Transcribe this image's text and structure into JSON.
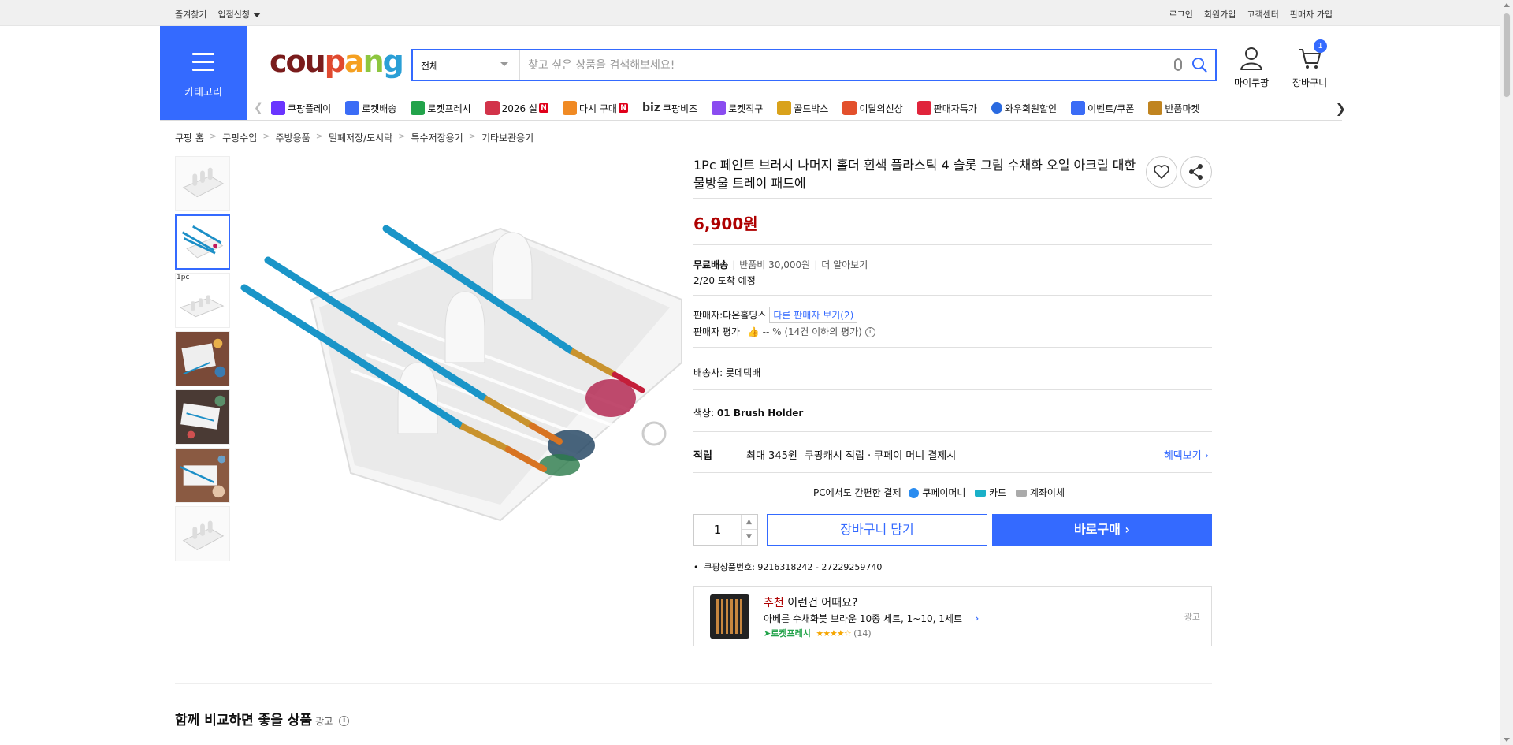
{
  "topbar": {
    "left": [
      "즐겨찾기",
      "입점신청"
    ],
    "right": [
      "로그인",
      "회원가입",
      "고객센터",
      "판매자 가입"
    ]
  },
  "header": {
    "category_label": "카테고리",
    "logo": [
      "c",
      "o",
      "u",
      "p",
      "a",
      "n",
      "g"
    ],
    "logo_colors": [
      "#7a1c1c",
      "#7a1c1c",
      "#7a1c1c",
      "#e0492f",
      "#f5a021",
      "#8dc63f",
      "#2a9fd6"
    ],
    "search_category": "전체",
    "search_placeholder": "찾고 싶은 상품을 검색해보세요!",
    "mycoupang": "마이쿠팡",
    "cart": "장바구니",
    "cart_count": "1"
  },
  "catnav": [
    {
      "label": "쿠팡플레이",
      "color": "#6a35ff",
      "badge": ""
    },
    {
      "label": "로켓배송",
      "color": "#3b6cf6",
      "badge": ""
    },
    {
      "label": "로켓프레시",
      "color": "#22a34a",
      "badge": ""
    },
    {
      "label": "2026 설",
      "color": "#d2334a",
      "badge": "N"
    },
    {
      "label": "다시 구매",
      "color": "#f08a24",
      "badge": "N"
    },
    {
      "label": "쿠팡비즈",
      "color": "#2b2b2b",
      "badge": "",
      "prefix": "biz"
    },
    {
      "label": "로켓직구",
      "color": "#8a4cf0",
      "badge": ""
    },
    {
      "label": "골드박스",
      "color": "#d9a21b",
      "badge": ""
    },
    {
      "label": "이달의신상",
      "color": "#e3502c",
      "badge": ""
    },
    {
      "label": "판매자특가",
      "color": "#e0243b",
      "badge": ""
    },
    {
      "label": "와우회원할인",
      "color": "#2a6ae0",
      "badge": "",
      "prefix": "wow"
    },
    {
      "label": "이벤트/쿠폰",
      "color": "#3b6cf6",
      "badge": ""
    },
    {
      "label": "반품마켓",
      "color": "#c08420",
      "badge": ""
    }
  ],
  "breadcrumb": [
    "쿠팡 홈",
    "쿠팡수입",
    "주방용품",
    "밀폐저장/도시락",
    "특수저장용기",
    "기타보관용기"
  ],
  "thumb_label": "1pc",
  "product": {
    "title": "1Pc 페인트 브러시 나머지 홀더 흰색 플라스틱 4 슬롯 그림 수채화 오일 아크릴 대한 물방울 트레이 패드에",
    "price": "6,900원",
    "free_shipping": "무료배송",
    "return_fee": "반품비 30,000원",
    "more": "더 알아보기",
    "arrival": "2/20 도착 예정",
    "seller_label": "판매자:",
    "seller": "다온홀딩스",
    "other_sellers": "다른 판매자 보기(2)",
    "seller_rating_label": "판매자 평가",
    "seller_rating": "-- % (14건 이하의 평가)",
    "courier_label": "배송사:",
    "courier": "롯데택배",
    "color_label": "색상:",
    "color_value": "01 Brush Holder",
    "reward_label": "적립",
    "reward_text1": "최대 345원",
    "reward_text2": "쿠팡캐시 적립",
    "reward_text3": "· 쿠페이 머니 결제시",
    "benefit": "혜택보기",
    "pay_title": "PC에서도 간편한 결제",
    "pay_methods": [
      "쿠페이머니",
      "카드",
      "계좌이체"
    ],
    "qty": "1",
    "add_cart": "장바구니 담기",
    "buy_now": "바로구매",
    "product_no": "쿠팡상품번호: 9216318242 - 27229259740"
  },
  "recommend": {
    "tag": "추천",
    "title": "이런건 어때요?",
    "name": "아베른 수채화붓 브라운 10종 세트, 1~10, 1세트",
    "rocket": "로켓프레시",
    "reviews": "(14)",
    "ad": "광고"
  },
  "section": {
    "title": "함께 비교하면 좋을 상품",
    "ad": "광고"
  }
}
